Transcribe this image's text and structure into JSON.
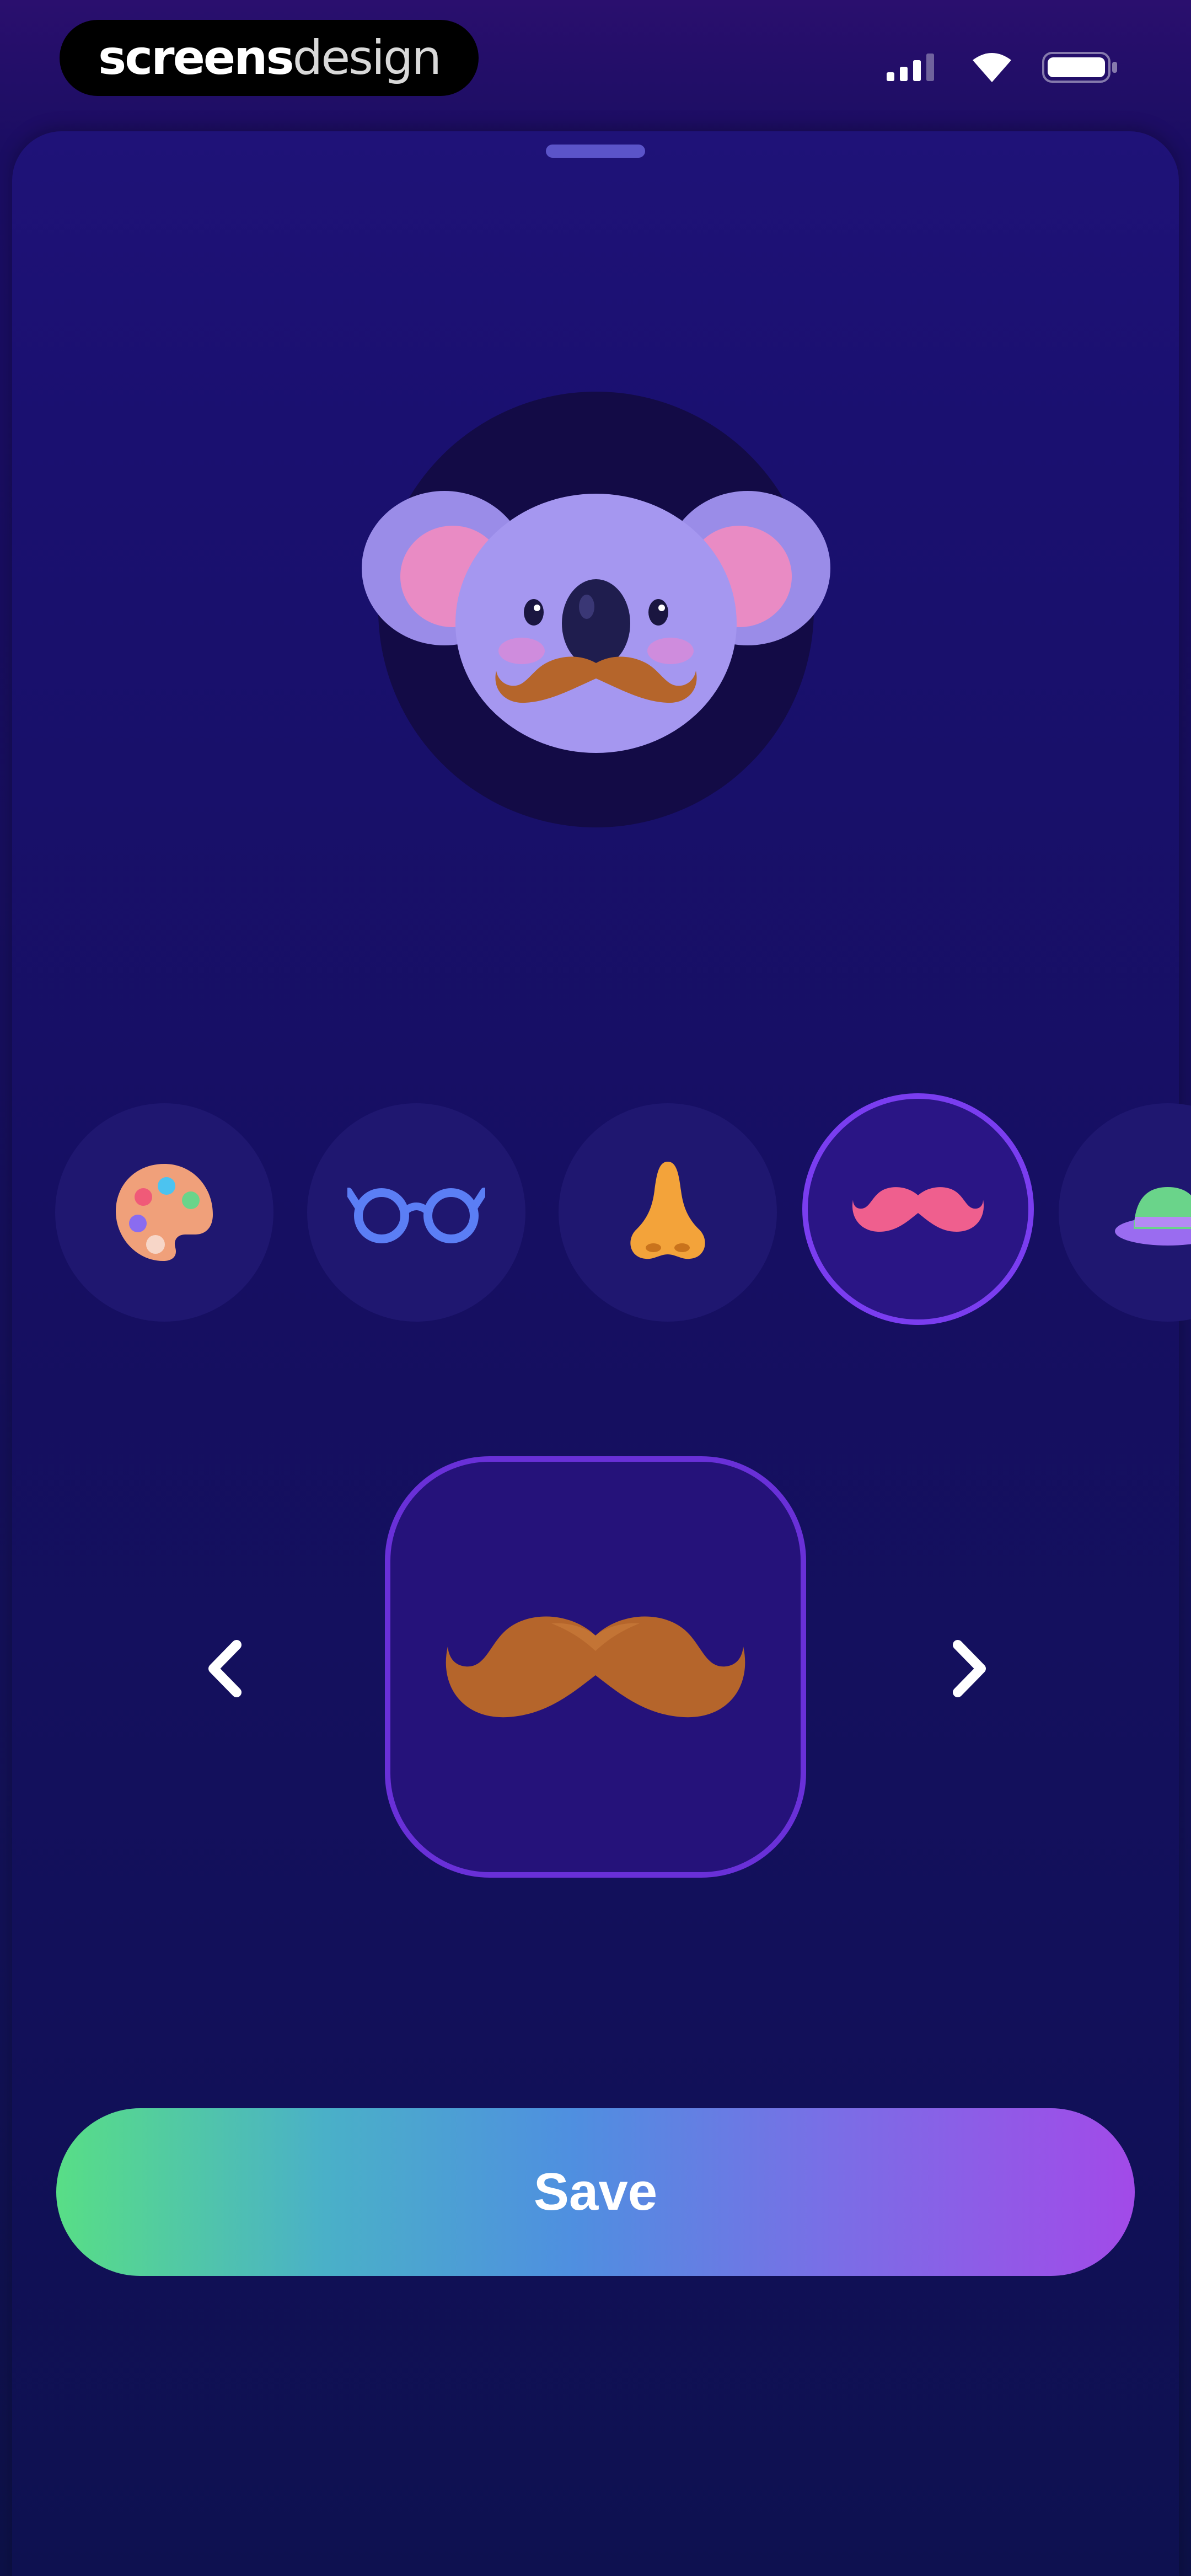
{
  "status_bar": {
    "brand_bold": "screens",
    "brand_light": "design",
    "icons": [
      "cellular-signal-icon",
      "wifi-icon",
      "battery-icon"
    ]
  },
  "avatar": {
    "character": "koala",
    "accessory": "mustache"
  },
  "categories": [
    {
      "name": "color",
      "icon": "palette-icon",
      "selected": false
    },
    {
      "name": "glasses",
      "icon": "glasses-icon",
      "selected": false
    },
    {
      "name": "nose",
      "icon": "nose-icon",
      "selected": false
    },
    {
      "name": "mustache",
      "icon": "mustache-icon",
      "selected": true
    },
    {
      "name": "hat",
      "icon": "hat-icon",
      "selected": false
    }
  ],
  "selector": {
    "prev_icon": "chevron-left-icon",
    "next_icon": "chevron-right-icon",
    "current_item": "mustache"
  },
  "save_button": {
    "label": "Save"
  },
  "colors": {
    "background": "#160e5c",
    "accent": "#7a3df0",
    "button_gradient_start": "#58de86",
    "button_gradient_end": "#a24ae8",
    "mustache": "#b5652b"
  }
}
